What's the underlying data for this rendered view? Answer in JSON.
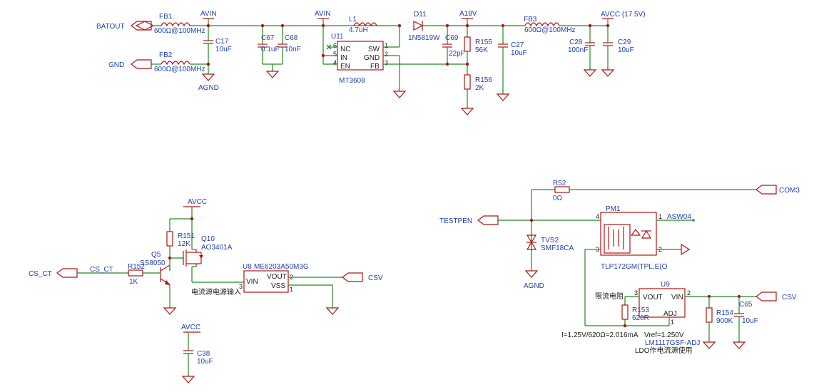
{
  "nets": {
    "batout": "BATOUT",
    "gnd": "GND",
    "avin": "AVIN",
    "agnd": "AGND",
    "a18v": "A18V",
    "avcc17": "AVCC (17.5V)",
    "avcc": "AVCC",
    "cs_ct": "CS_CT",
    "csv": "CSV",
    "com3": "COM3",
    "testpen": "TESTPEN",
    "asw04": "ASW04"
  },
  "components": {
    "fb1": {
      "ref": "FB1",
      "value": "600Ω@100MHz"
    },
    "fb2": {
      "ref": "FB2",
      "value": "600Ω@100MHz"
    },
    "fb3": {
      "ref": "FB3",
      "value": "600Ω@100MHz"
    },
    "c17": {
      "ref": "C17",
      "value": "10uF"
    },
    "c67": {
      "ref": "C67",
      "value": "0.1uF"
    },
    "c68": {
      "ref": "C68",
      "value": "10nF"
    },
    "u11": {
      "ref": "U11",
      "value": "MT3608",
      "pins": [
        "NC",
        "IN",
        "EN",
        "SW",
        "GND",
        "FB"
      ],
      "pin_numbers": [
        "6",
        "5",
        "4",
        "1",
        "2",
        "3"
      ]
    },
    "l1": {
      "ref": "L1",
      "value": "4.7uH"
    },
    "d11": {
      "ref": "D11",
      "value": "1N5819W"
    },
    "c69": {
      "ref": "C69",
      "value": "22pF"
    },
    "r155": {
      "ref": "R155",
      "value": "56K"
    },
    "r156": {
      "ref": "R156",
      "value": "2K"
    },
    "c27": {
      "ref": "C27",
      "value": "10uF"
    },
    "c28": {
      "ref": "C28",
      "value": "100nF"
    },
    "c29": {
      "ref": "C29",
      "value": "10uF"
    },
    "r151": {
      "ref": "R151",
      "value": "12K"
    },
    "q10": {
      "ref": "Q10",
      "value": "AO3401A"
    },
    "q5": {
      "ref": "Q5",
      "value": "SS8050"
    },
    "r152": {
      "ref": "R152",
      "value": "1K"
    },
    "u8": {
      "ref": "U8",
      "value": "ME6203A50M3G",
      "pins": [
        "VIN",
        "VOUT",
        "VSS"
      ],
      "pin_numbers": [
        "3",
        "2",
        "1"
      ]
    },
    "c38": {
      "ref": "C38",
      "value": "10uF"
    },
    "r52": {
      "ref": "R52",
      "value": "0Ω"
    },
    "tvs2": {
      "ref": "TVS2",
      "value": "SMF18CA"
    },
    "pm1": {
      "ref": "PM1",
      "value": "TLP172GM(TPL,E(O",
      "pin_numbers": [
        "4",
        "3",
        "1",
        "2"
      ]
    },
    "u9": {
      "ref": "U9",
      "value": "LM1117GSF-ADJ",
      "pins": [
        "VOUT",
        "VIN",
        "ADJ"
      ],
      "pin_numbers": [
        "3",
        "2",
        "1"
      ]
    },
    "r153": {
      "ref": "R153",
      "value": "620R"
    },
    "r154": {
      "ref": "R154",
      "value": "900K"
    },
    "c65": {
      "ref": "C65",
      "value": "10uF"
    }
  },
  "notes": {
    "current_input": "电流源电源输入",
    "current_limit": "限流电阻",
    "current_formula": "I=1.25V/620Ω=2.016mA",
    "vref": "Vref=1.250V",
    "ldo_note": "LDO作电流源使用"
  }
}
